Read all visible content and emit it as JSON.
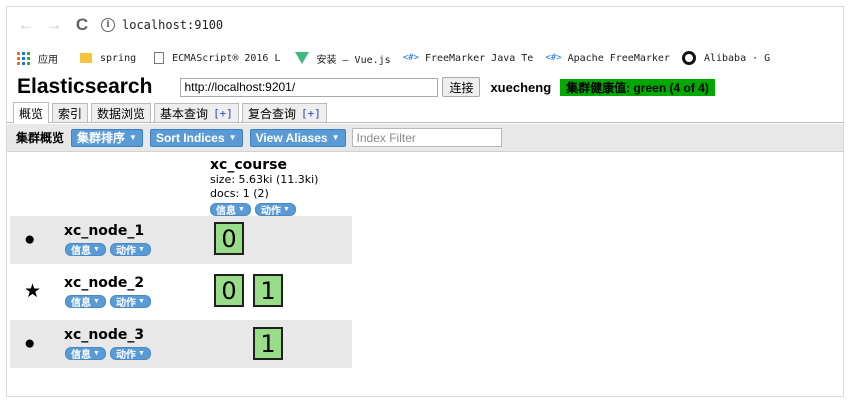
{
  "browser": {
    "url": "localhost:9100",
    "bookmarks": [
      {
        "label": "应用",
        "icon": "apps-grid-icon"
      },
      {
        "label": "spring",
        "icon": "folder-icon"
      },
      {
        "label": "ECMAScript® 2016 L",
        "icon": "document-icon"
      },
      {
        "label": "安装 — Vue.js",
        "icon": "vue-logo-icon"
      },
      {
        "label": "FreeMarker Java Te",
        "icon": "bookmark-tag-icon"
      },
      {
        "label": "Apache FreeMarker",
        "icon": "bookmark-tag-icon"
      },
      {
        "label": "Alibaba · G",
        "icon": "github-icon"
      }
    ]
  },
  "app": {
    "title": "Elasticsearch",
    "connect_url": "http://localhost:9201/",
    "connect_label": "连接",
    "cluster_name": "xuecheng",
    "health": "集群健康值: green (4 of 4)",
    "health_color": "#00a800"
  },
  "tabs": [
    {
      "label": "概览",
      "plus": ""
    },
    {
      "label": "索引",
      "plus": ""
    },
    {
      "label": "数据浏览",
      "plus": ""
    },
    {
      "label": "基本查询",
      "plus": "[+]"
    },
    {
      "label": "复合查询",
      "plus": "[+]"
    }
  ],
  "toolbar": {
    "label": "集群概览",
    "sort_cluster": "集群排序",
    "sort_indices": "Sort Indices",
    "view_aliases": "View Aliases",
    "filter_placeholder": "Index Filter",
    "button_color": "#5b9bd5"
  },
  "index": {
    "name": "xc_course",
    "size": "size: 5.63ki (11.3ki)",
    "docs": "docs: 1 (2)",
    "info_label": "信息",
    "action_label": "动作"
  },
  "nodes": [
    {
      "name": "xc_node_1",
      "symbol": "●",
      "info_label": "信息",
      "action_label": "动作",
      "shards": [
        "0"
      ]
    },
    {
      "name": "xc_node_2",
      "symbol": "★",
      "info_label": "信息",
      "action_label": "动作",
      "shards": [
        "0",
        "1"
      ]
    },
    {
      "name": "xc_node_3",
      "symbol": "●",
      "info_label": "信息",
      "action_label": "动作",
      "shards": [
        "1"
      ]
    }
  ],
  "shard_color": "#99dd88"
}
